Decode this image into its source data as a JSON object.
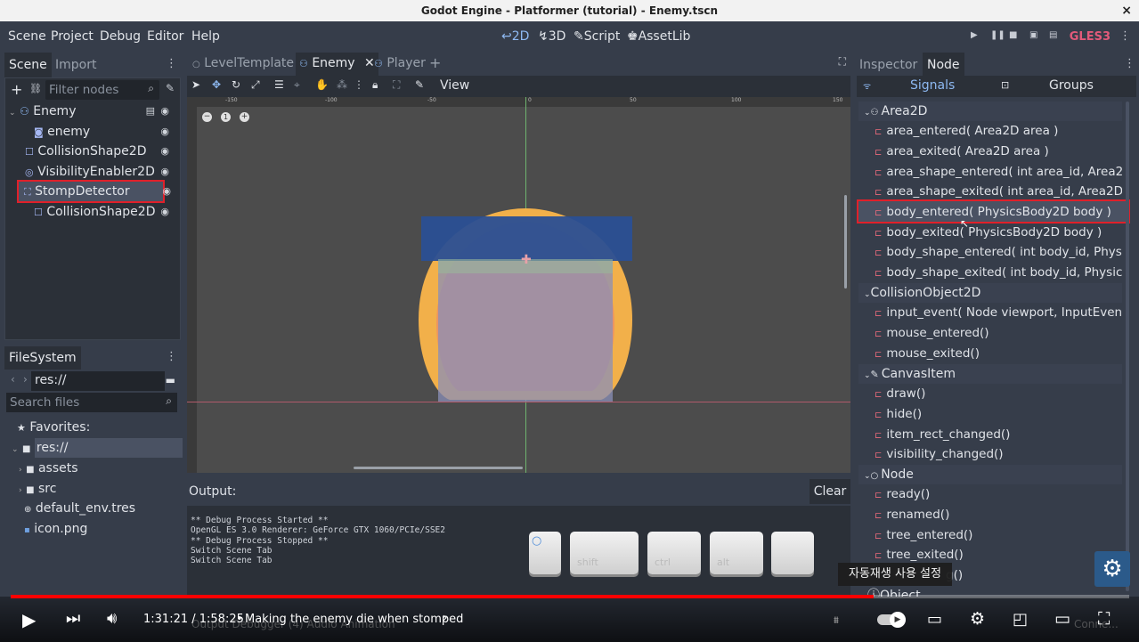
{
  "window": {
    "title": "Godot Engine - Platformer (tutorial) - Enemy.tscn",
    "close": "×"
  },
  "menu": [
    "Scene",
    "Project",
    "Debug",
    "Editor",
    "Help"
  ],
  "workspaces": [
    {
      "label": "2D",
      "icon": "↩"
    },
    {
      "label": "3D",
      "icon": "↯"
    },
    {
      "label": "Script",
      "icon": "✎"
    },
    {
      "label": "AssetLib",
      "icon": "♚"
    }
  ],
  "renderer": "GLES3",
  "scene_dock": {
    "tabs": [
      "Scene",
      "Import"
    ],
    "filter_placeholder": "Filter nodes",
    "nodes": [
      {
        "name": "Enemy",
        "indent": 0,
        "icon": "area"
      },
      {
        "name": "enemy",
        "indent": 1,
        "icon": "sprite"
      },
      {
        "name": "CollisionShape2D",
        "indent": 1,
        "icon": "shape"
      },
      {
        "name": "VisibilityEnabler2D",
        "indent": 1,
        "icon": "vis"
      },
      {
        "name": "StompDetector",
        "indent": 1,
        "icon": "area",
        "selected": true
      },
      {
        "name": "CollisionShape2D",
        "indent": 2,
        "icon": "shape"
      }
    ]
  },
  "filesystem": {
    "title": "FileSystem",
    "path": "res://",
    "search_placeholder": "Search files",
    "favorites": "Favorites:",
    "items": [
      {
        "name": "res://",
        "type": "folder",
        "indent": 0
      },
      {
        "name": "assets",
        "type": "folder",
        "indent": 1
      },
      {
        "name": "src",
        "type": "folder",
        "indent": 1
      },
      {
        "name": "default_env.tres",
        "type": "env",
        "indent": 1
      },
      {
        "name": "icon.png",
        "type": "image",
        "indent": 1
      }
    ]
  },
  "editor_tabs": [
    {
      "label": "LevelTemplate",
      "active": false
    },
    {
      "label": "Enemy",
      "active": true
    },
    {
      "label": "Player",
      "active": false
    }
  ],
  "viewport_toolbar": {
    "view_label": "View"
  },
  "ruler_marks": [
    "-150",
    "-100",
    "-50",
    "0",
    "50",
    "100",
    "150"
  ],
  "output": {
    "title": "Output:",
    "clear": "Clear",
    "lines": [
      "** Debug Process Started **",
      "OpenGL ES 3.0 Renderer: GeForce GTX 1060/PCIe/SSE2",
      "** Debug Process Stopped **",
      "Switch Scene Tab",
      "Switch Scene Tab"
    ],
    "bottom_tabs": "Output   Debugger (4)   Audio   Animation"
  },
  "keys": [
    "",
    "shift",
    "ctrl",
    "alt",
    ""
  ],
  "inspector": {
    "tabs": [
      "Inspector",
      "Node"
    ],
    "subtabs": [
      "Signals",
      "Groups"
    ],
    "classes": [
      {
        "name": "Area2D",
        "signals": [
          "area_entered( Area2D area )",
          "area_exited( Area2D area )",
          "area_shape_entered( int area_id, Area2D",
          "area_shape_exited( int area_id, Area2D ar",
          "body_entered( PhysicsBody2D body )",
          "body_exited( PhysicsBody2D body )",
          "body_shape_entered( int body_id, Physic",
          "body_shape_exited( int body_id, PhysicsB"
        ]
      },
      {
        "name": "CollisionObject2D",
        "signals": [
          "input_event( Node viewport, InputEvent",
          "mouse_entered()",
          "mouse_exited()"
        ]
      },
      {
        "name": "CanvasItem",
        "signals": [
          "draw()",
          "hide()",
          "item_rect_changed()",
          "visibility_changed()"
        ]
      },
      {
        "name": "Node",
        "signals": [
          "ready()",
          "renamed()",
          "tree_entered()",
          "tree_exited()",
          "g()"
        ]
      },
      {
        "name": "Object",
        "signals": []
      }
    ],
    "selected_signal": "body_entered( PhysicsBody2D body )"
  },
  "video": {
    "time": "1:31:21 / 1:58:25",
    "chapter": "Making the enemy die when stomped",
    "progress": 0.7713,
    "tooltip": "자동재생 사용 설정",
    "corner_text": "Conne..."
  }
}
